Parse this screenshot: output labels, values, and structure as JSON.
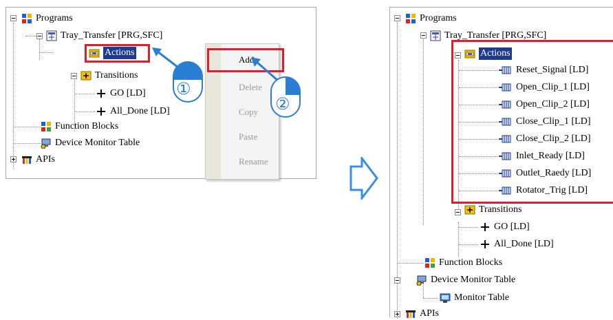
{
  "left_tree": {
    "programs": "Programs",
    "tray_transfer": "Tray_Transfer [PRG,SFC]",
    "actions": "Actions",
    "transitions": "Transitions",
    "go": "GO [LD]",
    "all_done": "All_Done [LD]",
    "function_blocks": "Function Blocks",
    "device_monitor_table": "Device Monitor Table",
    "apis": "APIs"
  },
  "context_menu": {
    "items": [
      {
        "label": "Add",
        "enabled": true
      },
      {
        "label": "Delete",
        "enabled": false
      },
      {
        "label": "Copy",
        "enabled": false
      },
      {
        "label": "Paste",
        "enabled": false
      },
      {
        "label": "Rename",
        "enabled": false
      }
    ]
  },
  "callouts": {
    "step1": "①",
    "step2": "②"
  },
  "right_tree": {
    "programs": "Programs",
    "tray_transfer": "Tray_Transfer [PRG,SFC]",
    "actions": "Actions",
    "action_items": [
      "Reset_Signal [LD]",
      "Open_Clip_1 [LD]",
      "Open_Clip_2 [LD]",
      "Close_Clip_1 [LD]",
      "Close_Clip_2 [LD]",
      "Inlet_Ready [LD]",
      "Outlet_Raedy [LD]",
      "Rotator_Trig [LD]"
    ],
    "transitions": "Transitions",
    "go": "GO [LD]",
    "all_done": "All_Done [LD]",
    "function_blocks": "Function Blocks",
    "device_monitor_table": "Device Monitor Table",
    "monitor_table": "Monitor Table",
    "apis": "APIs"
  },
  "colors": {
    "highlight_red": "#e01e2b",
    "selection_blue": "#1f3a93",
    "arrow_blue": "#2a7fd4"
  }
}
